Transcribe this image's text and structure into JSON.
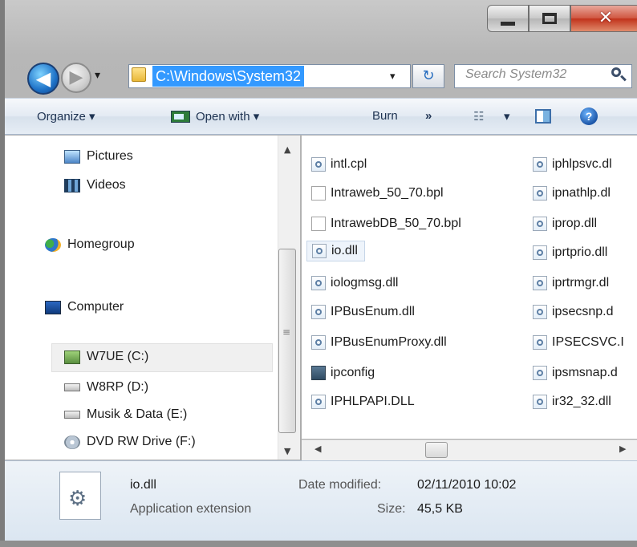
{
  "window": {
    "minimize_glyph": "minimize-icon",
    "maximize_glyph": "maximize-icon",
    "close_glyph": "✕"
  },
  "nav": {
    "back_glyph": "◀",
    "forward_glyph": "▶",
    "dropdown_glyph": "▾",
    "address": "C:\\Windows\\System32",
    "address_dropdown_glyph": "▾",
    "refresh_glyph": "↻",
    "search_placeholder": "Search System32"
  },
  "toolbar": {
    "organize": "Organize ▾",
    "open_with": "Open with ▾",
    "burn": "Burn",
    "more": "»",
    "views_dropdown": "▾",
    "help": "?"
  },
  "navpane": {
    "items": [
      {
        "label": "Pictures",
        "icon": "pictures-icon"
      },
      {
        "label": "Videos",
        "icon": "videos-icon"
      },
      {
        "label": "Homegroup",
        "icon": "homegroup-icon"
      },
      {
        "label": "Computer",
        "icon": "computer-icon"
      },
      {
        "label": "W7UE (C:)",
        "icon": "drive-icon"
      },
      {
        "label": "W8RP (D:)",
        "icon": "drive-icon"
      },
      {
        "label": "Musik & Data (E:)",
        "icon": "drive-icon"
      },
      {
        "label": "DVD RW Drive (F:)",
        "icon": "dvd-icon"
      }
    ]
  },
  "files": {
    "col1": [
      {
        "name": "intl.cpl",
        "type": "dll"
      },
      {
        "name": "Intraweb_50_70.bpl",
        "type": "bpl"
      },
      {
        "name": "IntrawebDB_50_70.bpl",
        "type": "bpl"
      },
      {
        "name": "io.dll",
        "type": "dll"
      },
      {
        "name": "iologmsg.dll",
        "type": "dll"
      },
      {
        "name": "IPBusEnum.dll",
        "type": "dll"
      },
      {
        "name": "IPBusEnumProxy.dll",
        "type": "dll"
      },
      {
        "name": "ipconfig",
        "type": "exe"
      },
      {
        "name": "IPHLPAPI.DLL",
        "type": "dll"
      }
    ],
    "col2": [
      {
        "name": "iphlpsvc.dl",
        "type": "dll"
      },
      {
        "name": "ipnathlp.dl",
        "type": "dll"
      },
      {
        "name": "iprop.dll",
        "type": "dll"
      },
      {
        "name": "iprtprio.dll",
        "type": "dll"
      },
      {
        "name": "iprtrmgr.dl",
        "type": "dll"
      },
      {
        "name": "ipsecsnp.d",
        "type": "dll"
      },
      {
        "name": "IPSECSVC.I",
        "type": "dll"
      },
      {
        "name": "ipsmsnap.d",
        "type": "dll"
      },
      {
        "name": "ir32_32.dll",
        "type": "dll"
      }
    ]
  },
  "details": {
    "filename": "io.dll",
    "filetype": "Application extension",
    "date_label": "Date modified:",
    "date_value": "02/11/2010 10:02",
    "size_label": "Size:",
    "size_value": "45,5 KB"
  }
}
